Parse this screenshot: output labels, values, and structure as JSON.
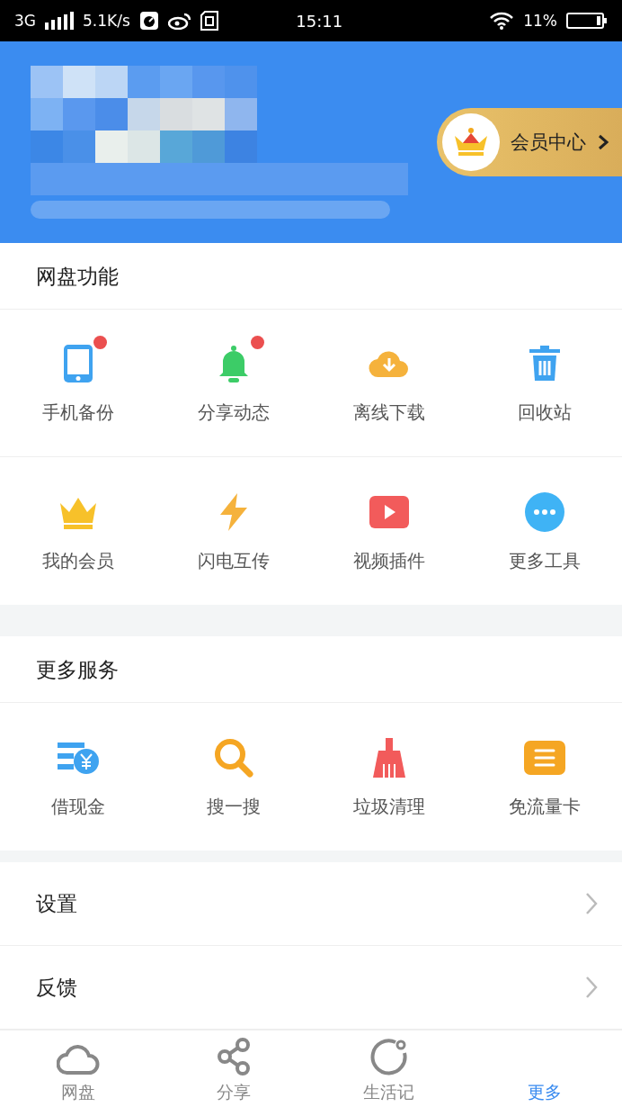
{
  "status_bar": {
    "network": "3G",
    "speed": "5.1K/s",
    "time": "15:11",
    "battery": "11%"
  },
  "header": {
    "member_button": "会员中心"
  },
  "sections": [
    {
      "title": "网盘功能",
      "tools": [
        {
          "label": "手机备份",
          "badge": true
        },
        {
          "label": "分享动态",
          "badge": true
        },
        {
          "label": "离线下载",
          "badge": false
        },
        {
          "label": "回收站",
          "badge": false
        },
        {
          "label": "我的会员",
          "badge": false
        },
        {
          "label": "闪电互传",
          "badge": false
        },
        {
          "label": "视频插件",
          "badge": false
        },
        {
          "label": "更多工具",
          "badge": false
        }
      ]
    },
    {
      "title": "更多服务",
      "tools": [
        {
          "label": "借现金",
          "badge": false
        },
        {
          "label": "搜一搜",
          "badge": false
        },
        {
          "label": "垃圾清理",
          "badge": false
        },
        {
          "label": "免流量卡",
          "badge": false
        }
      ]
    }
  ],
  "menu": [
    {
      "label": "设置"
    },
    {
      "label": "反馈"
    }
  ],
  "tabs": [
    {
      "label": "网盘",
      "selected": false
    },
    {
      "label": "分享",
      "selected": false
    },
    {
      "label": "生活记",
      "selected": false
    },
    {
      "label": "更多",
      "selected": true
    }
  ]
}
